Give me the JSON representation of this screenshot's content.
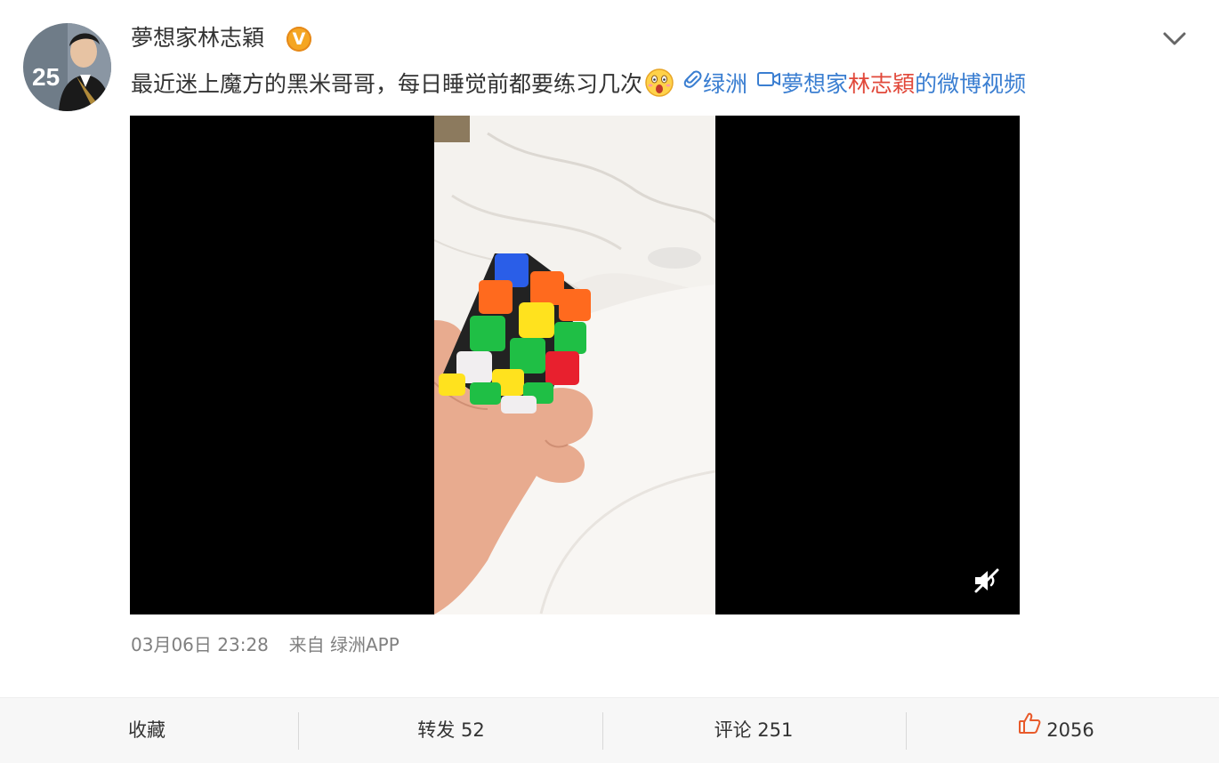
{
  "post": {
    "username": "夢想家林志穎",
    "verified_badge": "V",
    "text": "最近迷上魔方的黑米哥哥，每日睡觉前都要练习几次",
    "emoji": "surprised-face-emoji",
    "oasis_link": "绿洲",
    "video_link_prefix": "夢想家",
    "video_link_name": "林志穎",
    "video_link_suffix": "的微博视频",
    "avatar_badge": "25",
    "timestamp": "03月06日 23:28",
    "source_label": "来自",
    "source_app": "绿洲APP"
  },
  "video": {
    "muted": true
  },
  "actions": {
    "favorite_label": "收藏",
    "repost_label": "转发 52",
    "comment_label": "评论 251",
    "like_count": "2056"
  },
  "colors": {
    "link": "#3a7ed1",
    "highlight": "#e1483a",
    "meta": "#808080",
    "badge": "#f5a623"
  }
}
